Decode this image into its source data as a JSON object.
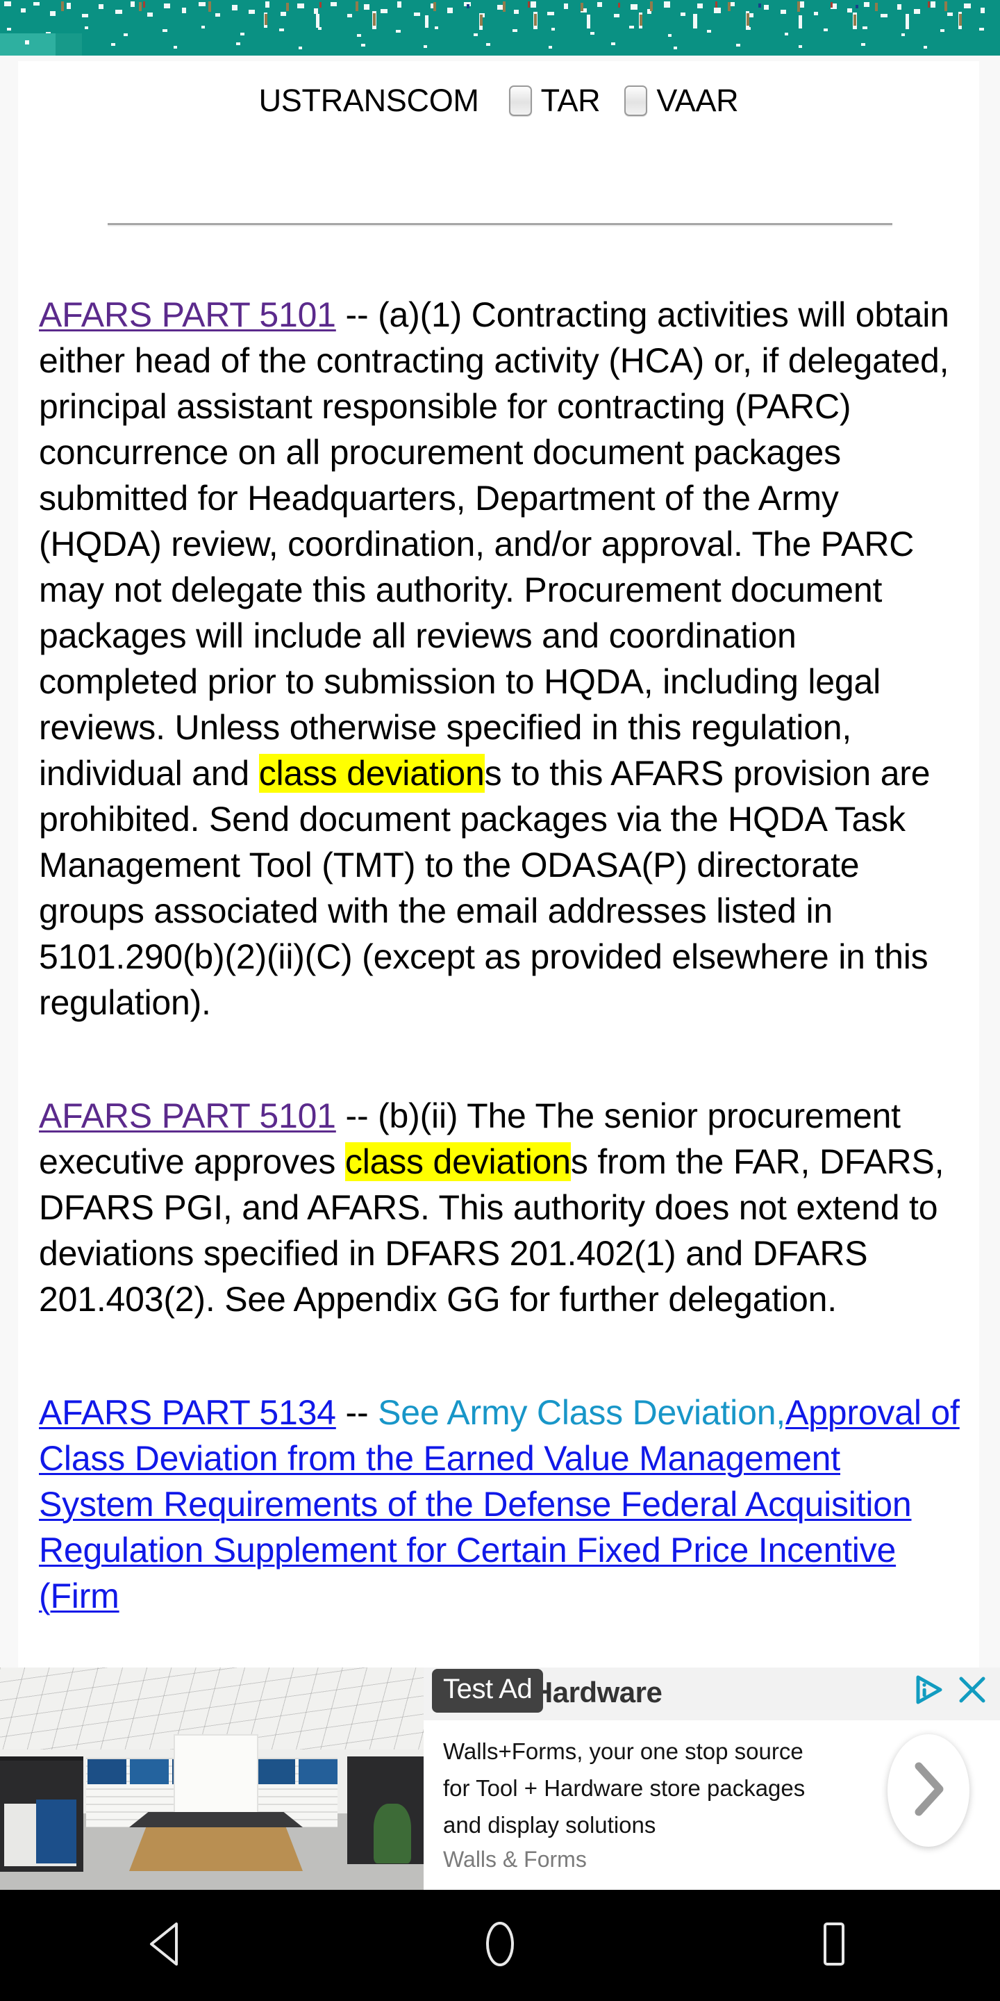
{
  "browser_chrome": {
    "appearance": "glitched-teal-bar",
    "base_color": "#0a9183",
    "patch_color": "#2eb0a0"
  },
  "doc_header": {
    "agency_label": "USTRANSCOM",
    "checkboxes": [
      {
        "label": "TAR",
        "checked": false
      },
      {
        "label": "VAAR",
        "checked": false
      }
    ]
  },
  "document": {
    "paragraphs": [
      {
        "link_label": "AFARS PART 5101",
        "link_style": "visited",
        "separator": " -- ",
        "body_before_highlight": "(a)(1) Contracting activities will obtain either head of the contracting activity (HCA) or, if delegated, principal assistant responsible for contracting (PARC) concurrence on all procurement document packages submitted for Headquarters, Department of the Army (HQDA) review, coordination, and/or approval. The PARC may not delegate this authority. Procurement document packages will include all reviews and coordination completed prior to submission to HQDA, including legal reviews. Unless otherwise specified in this regulation, individual and ",
        "highlight": "class deviation",
        "body_after_highlight": "s to this AFARS provision are prohibited. Send document packages via the HQDA Task Management Tool (TMT) to the ODASA(P) directorate groups associated with the email addresses listed in 5101.290(b)(2)(ii)(C) (except as provided elsewhere in this regulation)."
      },
      {
        "link_label": "AFARS PART 5101",
        "link_style": "visited",
        "separator": " -- ",
        "body_before_highlight": "(b)(ii) The The senior procurement executive approves ",
        "highlight": "class deviation",
        "body_after_highlight": "s from the FAR, DFARS, DFARS PGI, and AFARS. This authority does not extend to deviations specified in DFARS 201.402(1) and DFARS 201.403(2). See Appendix GG for further delegation."
      },
      {
        "link_label": "AFARS PART 5134",
        "link_style": "blue",
        "separator": " -- ",
        "teal_text": "See Army Class Deviation,",
        "second_link": "Approval of Class Deviation from the Earned Value Management System Requirements of the Defense Federal Acquisition Regulation Supplement for Certain Fixed Price Incentive (Firm"
      }
    ],
    "colors": {
      "visited_link": "#5b2a8c",
      "blue_link": "#1018e8",
      "teal_text": "#1896c8",
      "highlight": "#ffff00",
      "body_text": "#000000"
    }
  },
  "advertisement": {
    "test_badge": "Test Ad",
    "headline": "Tool + Hardware",
    "body": "Walls+Forms, your one stop source for Tool + Hardware store packages and display solutions",
    "advertiser": "Walls & Forms",
    "adchoices_icon": "adchoices-icon",
    "close_icon": "close-icon",
    "cta_icon": "chevron-right-icon",
    "accent_color": "#129cc0"
  },
  "navigation_bar": {
    "buttons": [
      {
        "name": "back",
        "icon": "back-triangle-icon"
      },
      {
        "name": "home",
        "icon": "home-circle-icon"
      },
      {
        "name": "recents",
        "icon": "recents-square-icon"
      }
    ],
    "background": "#000000"
  }
}
